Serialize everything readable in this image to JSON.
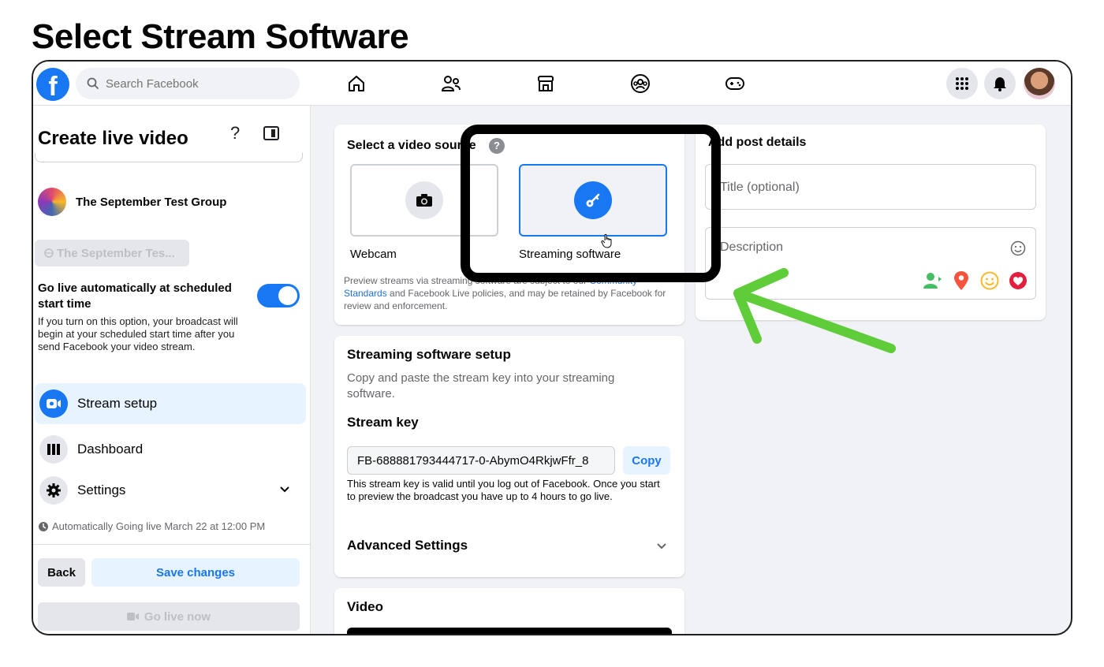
{
  "heading": "Select Stream Software",
  "topnav": {
    "logo": "f",
    "search_placeholder": "Search Facebook",
    "icons": [
      "home-icon",
      "friends-icon",
      "marketplace-icon",
      "groups-icon",
      "gaming-icon"
    ],
    "right_icons": [
      "menu-grid-icon",
      "notifications-bell-icon",
      "profile-avatar"
    ]
  },
  "left_panel": {
    "title": "Create live video",
    "help_glyph": "?",
    "group_name": "The September Test Group",
    "group_pill": "The September Tes...",
    "go_live_title": "Go live automatically at scheduled start time",
    "go_live_desc": "If you turn on this option, your broadcast will begin at your scheduled start time after you send Facebook your video stream.",
    "toggle_on": true,
    "menu": [
      {
        "label": "Stream setup",
        "icon": "video-camera-icon",
        "active": true
      },
      {
        "label": "Dashboard",
        "icon": "dashboard-icon",
        "active": false
      },
      {
        "label": "Settings",
        "icon": "gear-icon",
        "active": false
      }
    ],
    "auto_note": "Automatically Going live March 22 at 12:00 PM",
    "back_label": "Back",
    "save_label": "Save changes",
    "golive_label": "Go live now"
  },
  "video_source": {
    "title": "Select a video source",
    "options": [
      {
        "label": "Webcam",
        "icon": "camera-icon",
        "selected": false
      },
      {
        "label": "Streaming software",
        "icon": "key-icon",
        "selected": true
      }
    ],
    "preview_text_1": "Preview streams via streaming software are subject to our ",
    "preview_link": "Community Standards",
    "preview_text_2": " and Facebook Live policies, and may be retained by Facebook for review and enforcement."
  },
  "setup": {
    "title": "Streaming software setup",
    "desc": "Copy and paste the stream key into your streaming software.",
    "key_label": "Stream key",
    "key_value": "FB-688881793444717-0-AbymO4RkjwFfr_8",
    "copy_label": "Copy",
    "key_note": "This stream key is valid until you log out of Facebook. Once you start to preview the broadcast you have up to 4 hours to go live.",
    "advanced_label": "Advanced Settings"
  },
  "video_card": {
    "title": "Video"
  },
  "post_details": {
    "title": "Add post details",
    "title_placeholder": "Title (optional)",
    "description_placeholder": "Description",
    "action_icons": [
      "tag-people-icon",
      "location-pin-icon",
      "feeling-smiley-icon",
      "heart-sticker-icon"
    ]
  },
  "colors": {
    "brand": "#1877f2",
    "highlight": "#000000",
    "arrow": "#5fcd3a"
  }
}
